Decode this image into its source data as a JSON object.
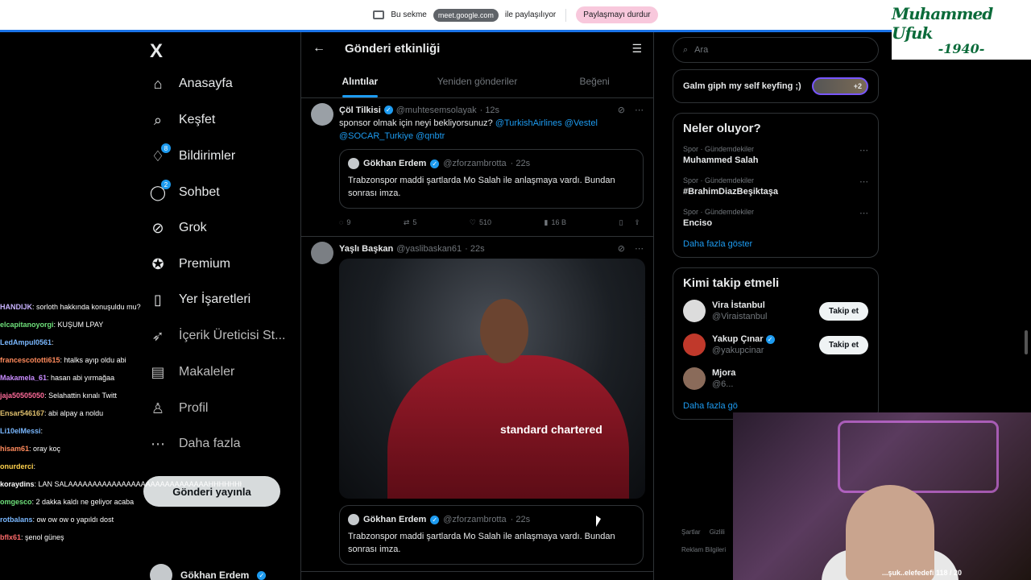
{
  "sharebar": {
    "text_before": "Bu sekme",
    "domain": "meet.google.com",
    "text_after": "ile paylaşılıyor",
    "stop_label": "Paylaşmayı durdur"
  },
  "watermark": {
    "name": "Muhammed Ufuk",
    "year": "-1940-"
  },
  "nav": {
    "logo": "X",
    "items": [
      {
        "label": "Anasayfa",
        "icon": "home-icon"
      },
      {
        "label": "Keşfet",
        "icon": "search-icon"
      },
      {
        "label": "Bildirimler",
        "icon": "bell-icon",
        "badge": "8"
      },
      {
        "label": "Sohbet",
        "icon": "chat-icon",
        "badge": "2"
      },
      {
        "label": "Grok",
        "icon": "grok-icon"
      },
      {
        "label": "Premium",
        "icon": "premium-icon"
      },
      {
        "label": "Yer İşaretleri",
        "icon": "bookmark-icon"
      },
      {
        "label": "İçerik Üreticisi St...",
        "icon": "rocket-icon"
      },
      {
        "label": "Makaleler",
        "icon": "article-icon"
      },
      {
        "label": "Profil",
        "icon": "profile-icon"
      },
      {
        "label": "Daha fazla",
        "icon": "more-icon"
      }
    ],
    "post_button": "Gönderi yayınla",
    "profile_name": "Gökhan Erdem"
  },
  "chat": [
    {
      "user": "HANDIJK",
      "msg": ": sorloth hakkında konuşuldu mu?",
      "color": "#c9b3ff"
    },
    {
      "user": "elcapitanoyorgi",
      "msg": ": KUŞUM LPAY",
      "color": "#6ee07a"
    },
    {
      "user": "LedAmpul0561",
      "msg": ":",
      "color": "#7ab8ff"
    },
    {
      "user": "francescototti615",
      "msg": ": htalks ayıp oldu abi",
      "color": "#ff8a5c"
    },
    {
      "user": "Makamela_61",
      "msg": ": hasan abi yırmağaa",
      "color": "#c98cff"
    },
    {
      "user": "jaja50505050",
      "msg": ": Selahattin kınalı Twitt",
      "color": "#ff6b9a"
    },
    {
      "user": "Ensar546167",
      "msg": ": abi alpay a noldu",
      "color": "#e0c06e"
    },
    {
      "user": "Li10elMessi",
      "msg": ":",
      "color": "#7ab8ff"
    },
    {
      "user": "hisam61",
      "msg": ": oray koç",
      "color": "#ff8a5c"
    },
    {
      "user": "onurderci",
      "msg": ":",
      "color": "#ffd24d"
    },
    {
      "user": "koraydins",
      "msg": ": LAN SALAAAAAAAAAAAAAAAAAAAAAAAAAAAAAHHHHHHHHHHH",
      "color": "#ffffff"
    },
    {
      "user": "omgesco",
      "msg": ": 2 dakka kaldı ne geliyor acaba",
      "color": "#6ee07a"
    },
    {
      "user": "rotbalans",
      "msg": ": ow ow ow o yapıldı dost",
      "color": "#7ab8ff"
    },
    {
      "user": "bflx61",
      "msg": ": şenol güneş",
      "color": "#ff6b6b"
    }
  ],
  "main": {
    "title": "Gönderi etkinliği",
    "tabs": [
      "Alıntılar",
      "Yeniden gönderiler",
      "Beğeni"
    ],
    "tweets": [
      {
        "name": "Çöl Tilkisi",
        "handle": "@muhtesemsolayak",
        "time": "· 12s",
        "text": "sponsor olmak için neyi bekliyorsunuz?",
        "mentions": "@TurkishAirlines @Vestel @SOCAR_Turkiye @qnbtr",
        "quote": {
          "name": "Gökhan Erdem",
          "handle": "@zforzambrotta",
          "time": "· 22s",
          "text": "Trabzonspor maddi şartlarda Mo Salah ile anlaşmaya vardı. Bundan sonrası imza."
        },
        "metrics": {
          "replies": "9",
          "reposts": "5",
          "likes": "510",
          "views": "16 B"
        }
      },
      {
        "name": "Yaşlı Başkan",
        "handle": "@yaslibaskan61",
        "time": "· 22s",
        "media_sponsor": "standard chartered",
        "quote": {
          "name": "Gökhan Erdem",
          "handle": "@zforzambrotta",
          "time": "· 22s",
          "text": "Trabzonspor maddi şartlarda Mo Salah ile anlaşmaya vardı. Bundan sonrası imza."
        }
      }
    ]
  },
  "right": {
    "search_placeholder": "Ara",
    "space": {
      "title": "Galm giph my self keyfing ;)",
      "extra": "+2"
    },
    "trends_title": "Neler oluyor?",
    "trends": [
      {
        "meta": "Spor · Gündemdekiler",
        "name": "Muhammed Salah"
      },
      {
        "meta": "Spor · Gündemdekiler",
        "name": "#BrahimDiazBeşiktaşa"
      },
      {
        "meta": "Spor · Gündemdekiler",
        "name": "Enciso"
      }
    ],
    "show_more": "Daha fazla göster",
    "follow_title": "Kimi takip etmeli",
    "follow": [
      {
        "name": "Vira İstanbul",
        "handle": "@Viraistanbul",
        "button": "Takip et"
      },
      {
        "name": "Yakup Çınar",
        "handle": "@yakupcinar",
        "button": "Takip et"
      },
      {
        "name": "Mjora",
        "handle": "@6..."
      }
    ],
    "follow_more": "Daha fazla gö",
    "footer": [
      "Şartlar",
      "Gizlili",
      "Reklam Bilgileri"
    ]
  },
  "webcam": {
    "ticker": "...şuk..elefedefi 118 / 20"
  }
}
